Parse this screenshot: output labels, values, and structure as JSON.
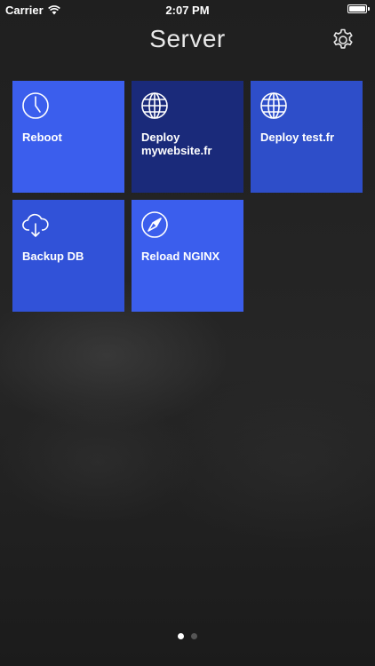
{
  "status_bar": {
    "carrier": "Carrier",
    "time": "2:07 PM",
    "battery_level": 1.0
  },
  "header": {
    "title": "Server",
    "settings_icon": "gear-icon"
  },
  "tiles": [
    {
      "label": "Reboot",
      "icon": "clock-icon",
      "color": "#3b5eed"
    },
    {
      "label": "Deploy\nmywebsite.fr",
      "icon": "globe-icon",
      "color": "#1a2a7a"
    },
    {
      "label": "Deploy test.fr",
      "icon": "globe-icon",
      "color": "#2e4ec9"
    },
    {
      "label": "Backup DB",
      "icon": "cloud-download-icon",
      "color": "#3152d8"
    },
    {
      "label": "Reload NGINX",
      "icon": "compass-icon",
      "color": "#3b5eed"
    }
  ],
  "page_indicator": {
    "count": 2,
    "current": 0,
    "active_color": "#ffffff",
    "inactive_color": "#555555"
  }
}
